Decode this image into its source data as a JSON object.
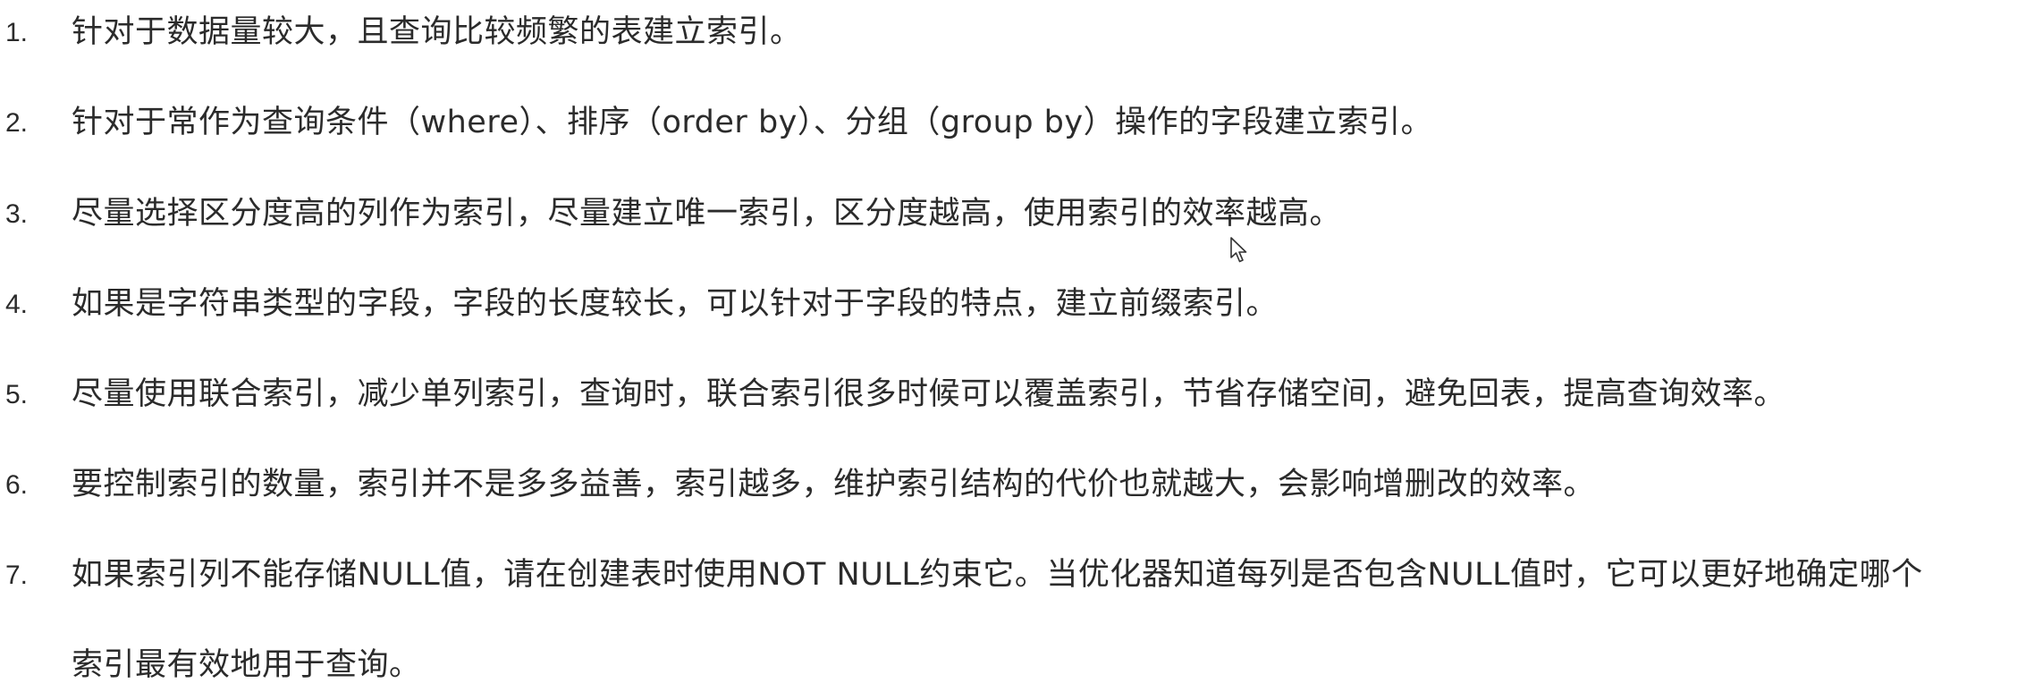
{
  "items": [
    {
      "number": "1.",
      "text": "针对于数据量较大，且查询比较频繁的表建立索引。"
    },
    {
      "number": "2.",
      "text": "针对于常作为查询条件（where）、排序（order by）、分组（group by）操作的字段建立索引。"
    },
    {
      "number": "3.",
      "text": "尽量选择区分度高的列作为索引，尽量建立唯一索引，区分度越高，使用索引的效率越高。"
    },
    {
      "number": "4.",
      "text": "如果是字符串类型的字段，字段的长度较长，可以针对于字段的特点，建立前缀索引。"
    },
    {
      "number": "5.",
      "text": "尽量使用联合索引，减少单列索引，查询时，联合索引很多时候可以覆盖索引，节省存储空间，避免回表，提高查询效率。"
    },
    {
      "number": "6.",
      "text": "要控制索引的数量，索引并不是多多益善，索引越多，维护索引结构的代价也就越大，会影响增删改的效率。"
    },
    {
      "number": "7.",
      "text": "如果索引列不能存储NULL值，请在创建表时使用NOT NULL约束它。当优化器知道每列是否包含NULL值时，它可以更好地确定哪个",
      "continuation": "索引最有效地用于查询。"
    }
  ],
  "cursor_icon": "mouse-pointer-icon"
}
